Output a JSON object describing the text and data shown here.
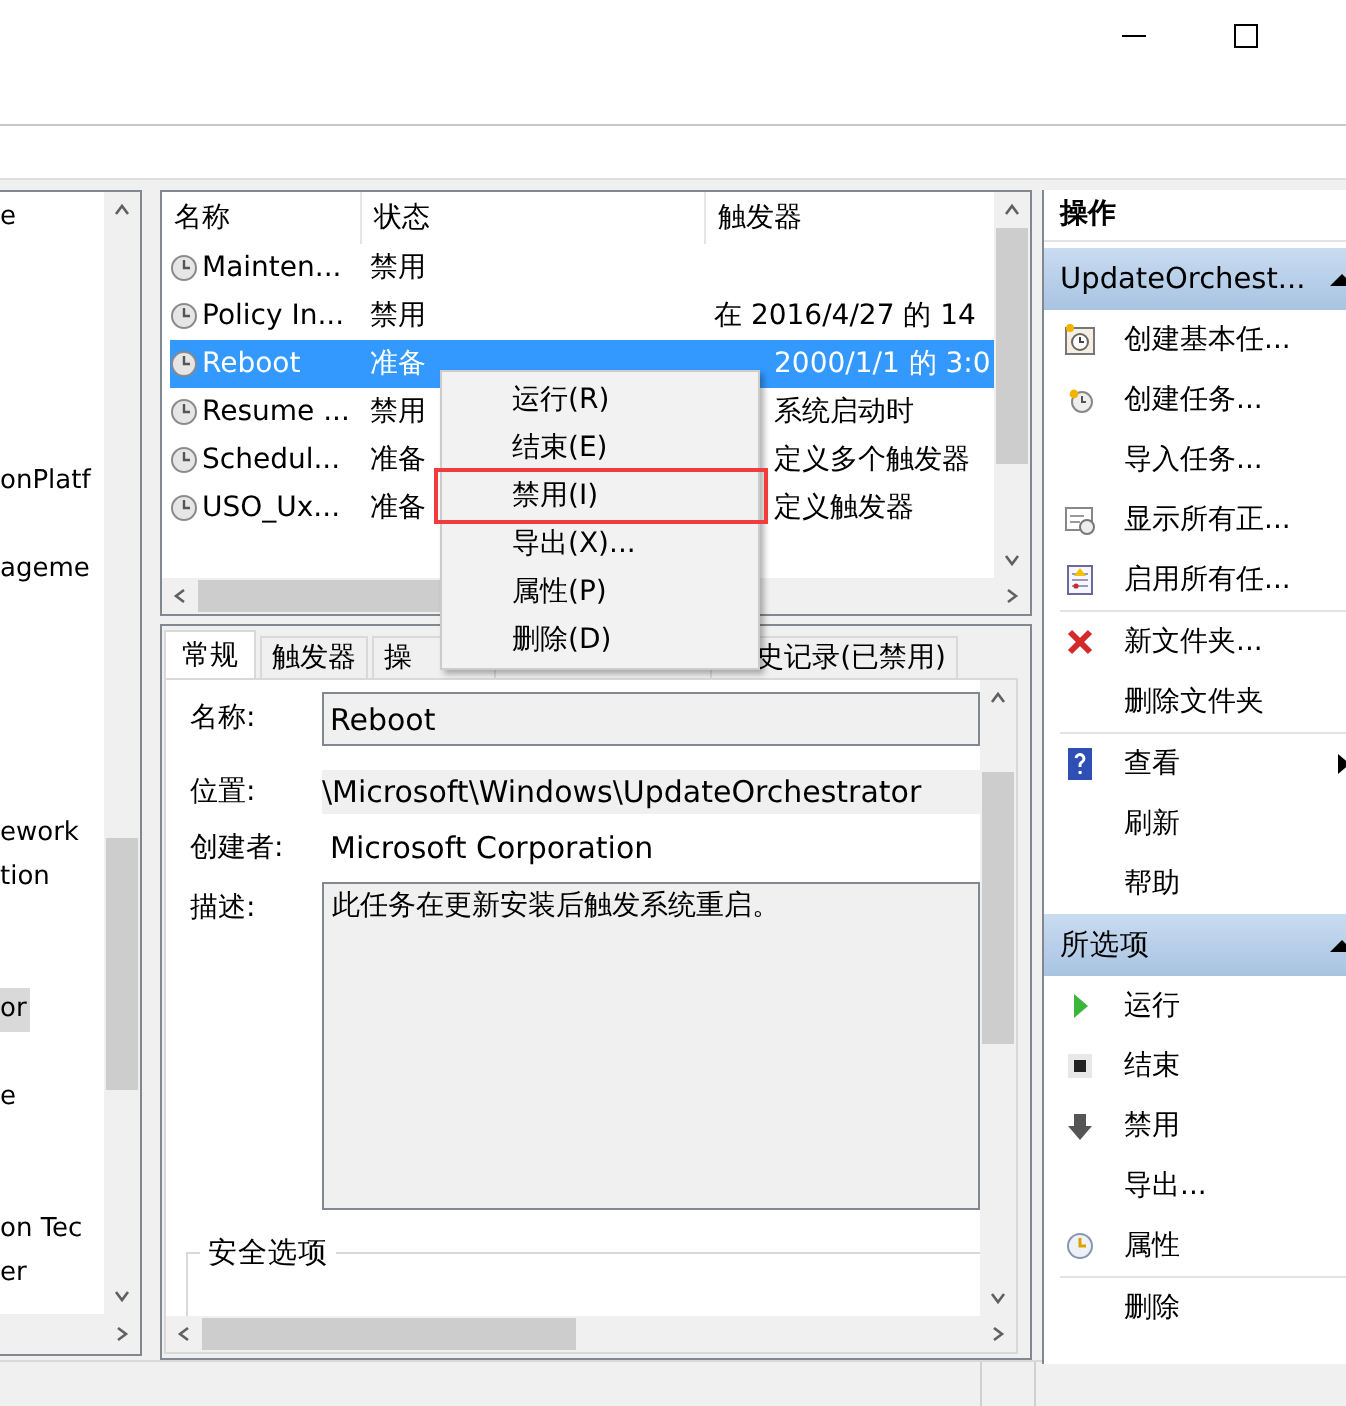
{
  "window": {
    "controls": [
      {
        "kind": "minimize"
      },
      {
        "kind": "maximize"
      }
    ]
  },
  "tree": {
    "items": [
      {
        "label": "e",
        "selected": false
      },
      {
        "label": "onPlatf",
        "selected": false
      },
      {
        "label": "ageme",
        "selected": false
      },
      {
        "label": "ework",
        "selected": false
      },
      {
        "label": "tion",
        "selected": false
      },
      {
        "label": "or",
        "selected": true
      },
      {
        "label": "e",
        "selected": false
      },
      {
        "label": "on Tec",
        "selected": false
      },
      {
        "label": "er",
        "selected": false
      }
    ]
  },
  "task_list": {
    "columns": [
      "名称",
      "状态",
      "触发器"
    ],
    "rows": [
      {
        "name": "Mainten...",
        "status": "禁用",
        "selected": false
      },
      {
        "name": "Policy In...",
        "status": "禁用",
        "trigger": "在 2016/4/27 的 14",
        "selected": false
      },
      {
        "name": "Reboot",
        "status": "准备",
        "trigger": "2000/1/1 的 3:0",
        "selected": true
      },
      {
        "name": "Resume ...",
        "status": "禁用",
        "trigger": "系统启动时",
        "selected": false
      },
      {
        "name": "Schedul...",
        "status": "准备",
        "trigger": "定义多个触发器",
        "selected": false
      },
      {
        "name": "USO_Ux...",
        "status": "准备",
        "trigger": "定义触发器",
        "selected": false
      }
    ]
  },
  "context_menu": {
    "items": [
      {
        "label": "运行(R)",
        "annotated": false
      },
      {
        "label": "结束(E)",
        "annotated": false
      },
      {
        "label": "禁用(I)",
        "annotated": true
      },
      {
        "label": "导出(X)...",
        "annotated": false
      },
      {
        "label": "属性(P)",
        "annotated": false
      },
      {
        "label": "删除(D)",
        "annotated": false
      }
    ]
  },
  "details": {
    "tabs": [
      {
        "label": "常规",
        "selected": true
      },
      {
        "label": "触发器",
        "selected": false
      },
      {
        "label": "操",
        "selected": false
      },
      {
        "label": "史记录(已禁用)",
        "selected": false
      }
    ],
    "fields": [
      {
        "kind": "input",
        "label": "名称:",
        "value": "Reboot"
      },
      {
        "kind": "readonly",
        "label": "位置:",
        "value": "\\Microsoft\\Windows\\UpdateOrchestrator"
      },
      {
        "kind": "text",
        "label": "创建者:",
        "value": "Microsoft Corporation"
      },
      {
        "kind": "textarea",
        "label": "描述:",
        "value": "此任务在更新安装后触发系统重启。"
      }
    ],
    "security_group": {
      "title": "安全选项"
    }
  },
  "actions": {
    "title": "操作",
    "sections": [
      {
        "title": "UpdateOrchest...",
        "expanded": true,
        "items": [
          {
            "kind": "action",
            "label": "创建基本任..."
          },
          {
            "kind": "action",
            "label": "创建任务..."
          },
          {
            "kind": "action",
            "label": "导入任务..."
          },
          {
            "kind": "action",
            "label": "显示所有正..."
          },
          {
            "kind": "action",
            "label": "启用所有任..."
          },
          {
            "kind": "separator"
          },
          {
            "kind": "action",
            "label": "新文件夹..."
          },
          {
            "kind": "action",
            "label": "删除文件夹"
          },
          {
            "kind": "separator"
          },
          {
            "kind": "action",
            "label": "查看",
            "submenu": true
          },
          {
            "kind": "action",
            "label": "刷新"
          },
          {
            "kind": "action",
            "label": "帮助"
          }
        ]
      },
      {
        "title": "所选项",
        "expanded": true,
        "items": [
          {
            "kind": "action",
            "label": "运行"
          },
          {
            "kind": "action",
            "label": "结束"
          },
          {
            "kind": "action",
            "label": "禁用"
          },
          {
            "kind": "action",
            "label": "导出..."
          },
          {
            "kind": "action",
            "label": "属性"
          },
          {
            "kind": "separator"
          },
          {
            "kind": "action",
            "label": "删除"
          }
        ]
      }
    ]
  }
}
